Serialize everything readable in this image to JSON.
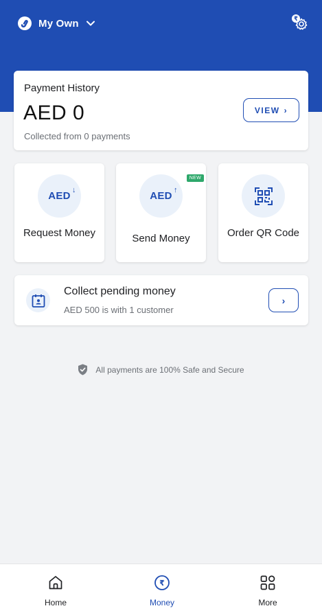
{
  "header": {
    "account_name": "My Own",
    "brand_logo_icon": "jio-logo-icon",
    "dropdown_icon": "chevron-down-icon",
    "settings_icon": "rupee-gear-settings-icon",
    "background_color": "#1f4db3"
  },
  "payment_history": {
    "title": "Payment History",
    "amount": "AED 0",
    "subtitle": "Collected from 0 payments",
    "view_button": "VIEW",
    "view_icon": "chevron-right-icon"
  },
  "actions": [
    {
      "label": "Request Money",
      "icon_text": "AED",
      "icon_arrow": "↓",
      "icon": "aed-down-arrow-icon"
    },
    {
      "label": "Send Money",
      "icon_text": "AED",
      "icon_arrow": "↑",
      "icon": "aed-up-arrow-icon",
      "badge": "NEW"
    },
    {
      "label": "Order QR Code",
      "icon": "qr-code-icon"
    }
  ],
  "pending": {
    "title": "Collect pending money",
    "subtitle": "AED 500 is with 1 customer",
    "icon": "calendar-person-icon",
    "button_icon": "chevron-right-icon"
  },
  "secure": {
    "text": "All payments are 100% Safe and Secure",
    "icon": "shield-check-icon"
  },
  "nav": {
    "items": [
      {
        "label": "Home",
        "icon": "home-icon",
        "active": false
      },
      {
        "label": "Money",
        "icon": "rupee-circle-icon",
        "active": true
      },
      {
        "label": "More",
        "icon": "grid-more-icon",
        "active": false
      }
    ]
  },
  "colors": {
    "accent": "#1f4db3",
    "badge_new": "#2ea86b",
    "icon_bg": "#eaf1fa",
    "page_bg": "#f2f3f5"
  }
}
